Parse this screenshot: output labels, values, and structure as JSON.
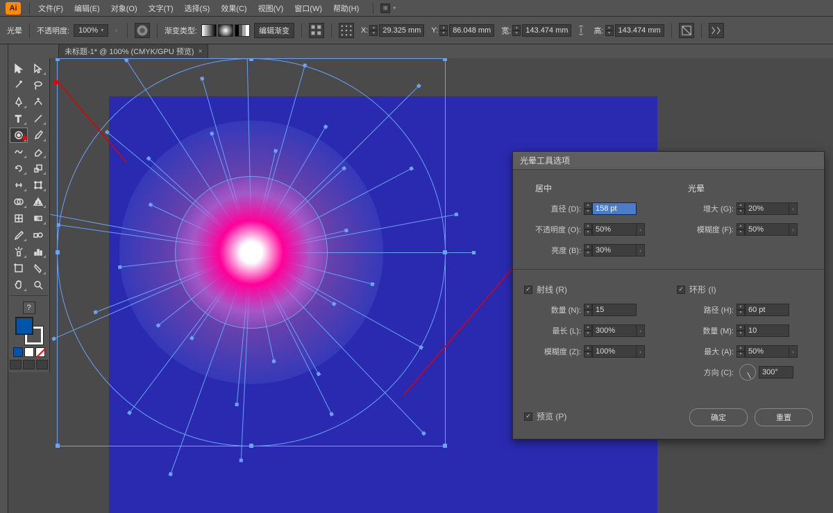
{
  "app": {
    "logo": "Ai"
  },
  "menu": {
    "items": [
      "文件(F)",
      "编辑(E)",
      "对象(O)",
      "文字(T)",
      "选择(S)",
      "效果(C)",
      "视图(V)",
      "窗口(W)",
      "帮助(H)"
    ]
  },
  "controlbar": {
    "mode": "光晕",
    "opacity_label": "不透明度:",
    "opacity_value": "100%",
    "grad_type_label": "渐变类型:",
    "edit_grad": "编辑渐变",
    "x_label": "X:",
    "x_value": "29.325 mm",
    "y_label": "Y:",
    "y_value": "86.048 mm",
    "w_label": "宽:",
    "w_value": "143.474 mm",
    "h_label": "高:",
    "h_value": "143.474 mm"
  },
  "tab": {
    "title": "未标题-1* @ 100% (CMYK/GPU 预览)"
  },
  "dialog": {
    "title": "光晕工具选项",
    "sections": {
      "center": "居中",
      "diameter_label": "直径 (D):",
      "diameter_value": "158 pt",
      "opacity_label": "不透明度 (O):",
      "opacity_value": "50%",
      "brightness_label": "亮度 (B):",
      "brightness_value": "30%",
      "halo": "光晕",
      "grow_label": "增大 (G):",
      "grow_value": "20%",
      "halo_fuzz_label": "模糊度 (F):",
      "halo_fuzz_value": "50%",
      "rays_check": "射线 (R)",
      "count_label": "数量 (N):",
      "count_value": "15",
      "longest_label": "最长 (L):",
      "longest_value": "300%",
      "rays_fuzz_label": "模糊度 (Z):",
      "rays_fuzz_value": "100%",
      "rings_check": "环形 (I)",
      "path_label": "路径 (H):",
      "path_value": "60 pt",
      "rings_count_label": "数量 (M):",
      "rings_count_value": "10",
      "largest_label": "最大 (A):",
      "largest_value": "50%",
      "direction_label": "方向 (C):",
      "direction_value": "300°",
      "preview": "预览 (P)",
      "ok": "确定",
      "reset": "重置"
    }
  },
  "toolbox": {
    "question": "?"
  }
}
